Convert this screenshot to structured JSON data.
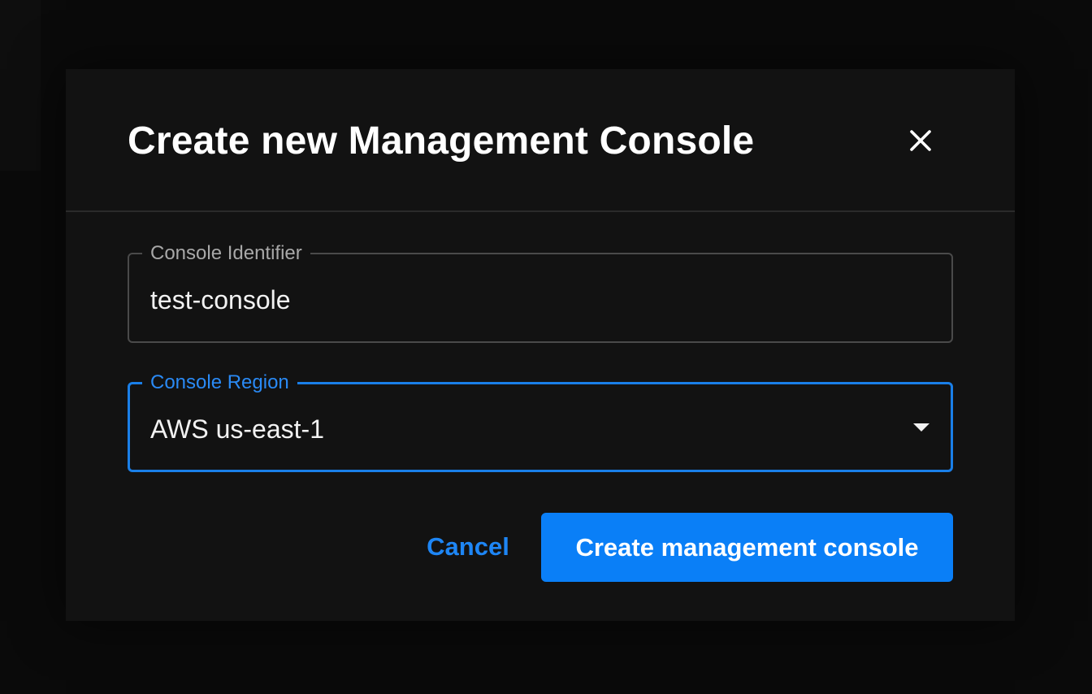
{
  "dialog": {
    "title": "Create new Management Console",
    "close_icon": "close-icon"
  },
  "form": {
    "identifier": {
      "label": "Console Identifier",
      "value": "test-console"
    },
    "region": {
      "label": "Console Region",
      "value": "AWS us-east-1",
      "icon": "chevron-down-icon",
      "focused": true
    }
  },
  "actions": {
    "cancel_label": "Cancel",
    "create_label": "Create management console"
  },
  "colors": {
    "accent": "#0a7ff7",
    "link": "#1e86f5",
    "surface": "#121212",
    "backdrop": "#0a0a0a"
  }
}
